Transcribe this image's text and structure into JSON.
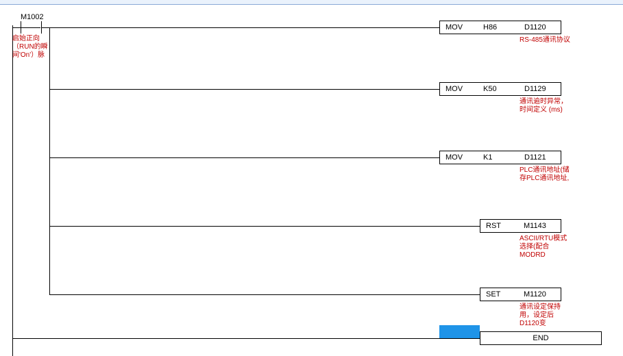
{
  "contact": {
    "name": "M1002",
    "comment": "启始正向（RUN的瞬间'On'）脉"
  },
  "rungs": [
    {
      "op": "MOV",
      "opr1": "H86",
      "opr2": "D1120",
      "comment": "RS-485通讯协议"
    },
    {
      "op": "MOV",
      "opr1": "K50",
      "opr2": "D1129",
      "comment": "通讯逾时异常，时间定义 (ms)"
    },
    {
      "op": "MOV",
      "opr1": "K1",
      "opr2": "D1121",
      "comment": "PLC通讯地址(储存PLC通讯地址,"
    },
    {
      "op": "RST",
      "opr1": "M1143",
      "opr2": "",
      "comment": "ASCII/RTU模式选择(配合MODRD"
    },
    {
      "op": "SET",
      "opr1": "M1120",
      "opr2": "",
      "comment": "通讯设定保持用，设定后D1120变"
    }
  ],
  "end": {
    "label": "END"
  }
}
